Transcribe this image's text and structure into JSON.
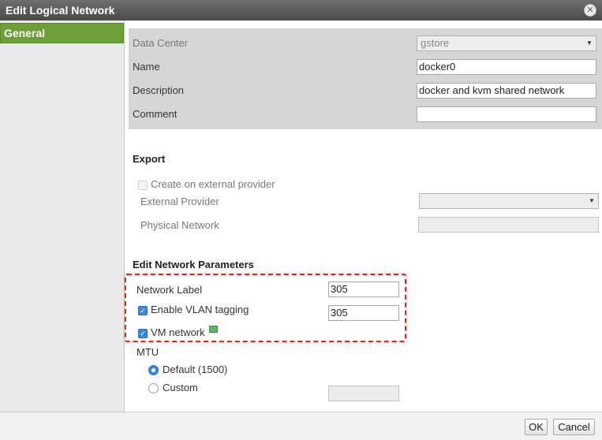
{
  "dialog": {
    "title": "Edit Logical Network",
    "close_glyph": "✕"
  },
  "sidebar": {
    "tabs": [
      {
        "label": "General"
      }
    ]
  },
  "general": {
    "data_center_label": "Data Center",
    "data_center_value": "gstore",
    "name_label": "Name",
    "name_value": "docker0",
    "description_label": "Description",
    "description_value": "docker and kvm shared network",
    "comment_label": "Comment",
    "comment_value": ""
  },
  "export": {
    "heading": "Export",
    "create_external_label": "Create on external provider",
    "create_external_checked": false,
    "external_provider_label": "External Provider",
    "external_provider_value": "",
    "physical_network_label": "Physical Network",
    "physical_network_value": ""
  },
  "params": {
    "heading": "Edit Network Parameters",
    "network_label_label": "Network Label",
    "network_label_value": "305",
    "vlan_label": "Enable VLAN tagging",
    "vlan_checked": true,
    "vlan_value": "305",
    "vm_network_label": "VM network",
    "vm_network_checked": true,
    "vm_network_icon": "vm-network-icon",
    "mtu_label": "MTU",
    "mtu_default_label": "Default (1500)",
    "mtu_default_selected": true,
    "mtu_custom_label": "Custom",
    "mtu_custom_value": ""
  },
  "footer": {
    "ok_label": "OK",
    "cancel_label": "Cancel"
  },
  "colors": {
    "accent_tab": "#6d9f37",
    "highlight_border": "#d92b1c",
    "checkbox_checked": "#3b87e0"
  }
}
